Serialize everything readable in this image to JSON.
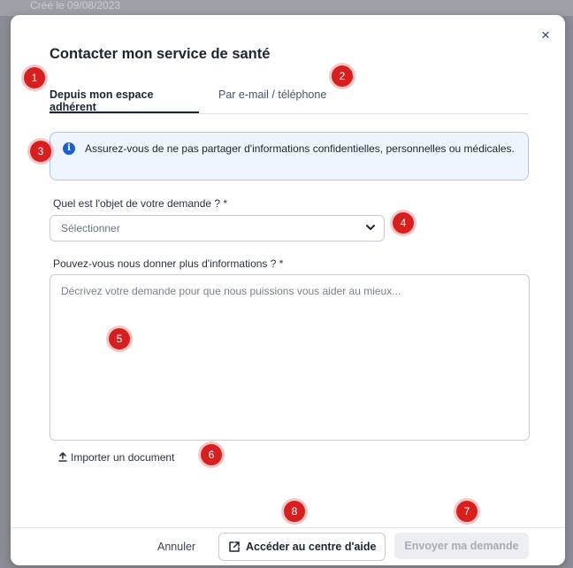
{
  "background": {
    "text": "Créé le 09/08/2023"
  },
  "modal": {
    "title": "Contacter mon service de santé",
    "close_label": "×",
    "tabs": [
      {
        "label": "Depuis mon espace adhérent",
        "active": true
      },
      {
        "label": "Par e-mail / téléphone",
        "active": false
      }
    ],
    "info": {
      "icon": "info-icon",
      "text": "Assurez-vous de ne pas partager d'informations confidentielles, personnelles ou médicales."
    },
    "subject": {
      "label": "Quel est l'objet de votre demande ? *",
      "value": "Sélectionner"
    },
    "details": {
      "label": "Pouvez-vous nous donner plus d'informations ? *",
      "placeholder": "Décrivez votre demande pour que nous puissions vous aider au mieux..."
    },
    "upload_label": "Importer un document",
    "footer": {
      "cancel_label": "Annuler",
      "help_label": "Accéder au centre d'aide",
      "send_label": "Envoyer ma demande"
    }
  },
  "markers": [
    "1",
    "2",
    "3",
    "4",
    "5",
    "6",
    "7",
    "8"
  ],
  "colors": {
    "marker": "#d61f1f",
    "info_bg": "#eef5fd",
    "info_icon": "#1e5fc9",
    "title": "#1d2432"
  }
}
